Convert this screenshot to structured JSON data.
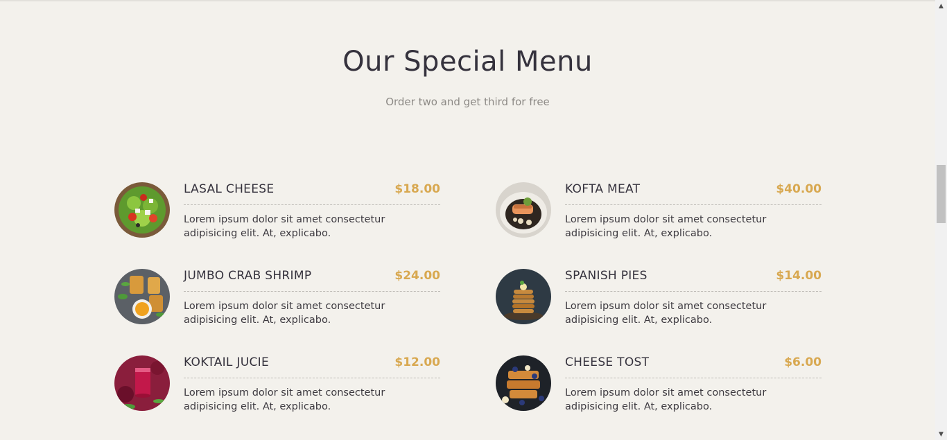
{
  "section": {
    "title": "Our Special Menu",
    "subtitle": "Order two and get third for free"
  },
  "menu": {
    "items": [
      {
        "name": "LASAL CHEESE",
        "price": "$18.00",
        "description": "Lorem ipsum dolor sit amet consectetur adipisicing elit. At, explicabo.",
        "image_icon": "salad-image"
      },
      {
        "name": "KOFTA MEAT",
        "price": "$40.00",
        "description": "Lorem ipsum dolor sit amet consectetur adipisicing elit. At, explicabo.",
        "image_icon": "salmon-dish-image"
      },
      {
        "name": "JUMBO CRAB SHRIMP",
        "price": "$24.00",
        "description": "Lorem ipsum dolor sit amet consectetur adipisicing elit. At, explicabo.",
        "image_icon": "crab-shrimp-image"
      },
      {
        "name": "SPANISH PIES",
        "price": "$14.00",
        "description": "Lorem ipsum dolor sit amet consectetur adipisicing elit. At, explicabo.",
        "image_icon": "pancake-stack-image"
      },
      {
        "name": "KOKTAIL JUCIE",
        "price": "$12.00",
        "description": "Lorem ipsum dolor sit amet consectetur adipisicing elit. At, explicabo.",
        "image_icon": "beet-juice-image"
      },
      {
        "name": "CHEESE TOST",
        "price": "$6.00",
        "description": "Lorem ipsum dolor sit amet consectetur adipisicing elit. At, explicabo.",
        "image_icon": "french-toast-image"
      }
    ]
  },
  "scrollbar": {
    "up_icon": "scroll-up-arrow-icon",
    "down_icon": "scroll-down-arrow-icon"
  },
  "colors": {
    "background": "#f3f1ec",
    "title": "#35323d",
    "subtitle": "#8d8a86",
    "price_accent": "#d8a850",
    "divider": "#bdbab5"
  }
}
